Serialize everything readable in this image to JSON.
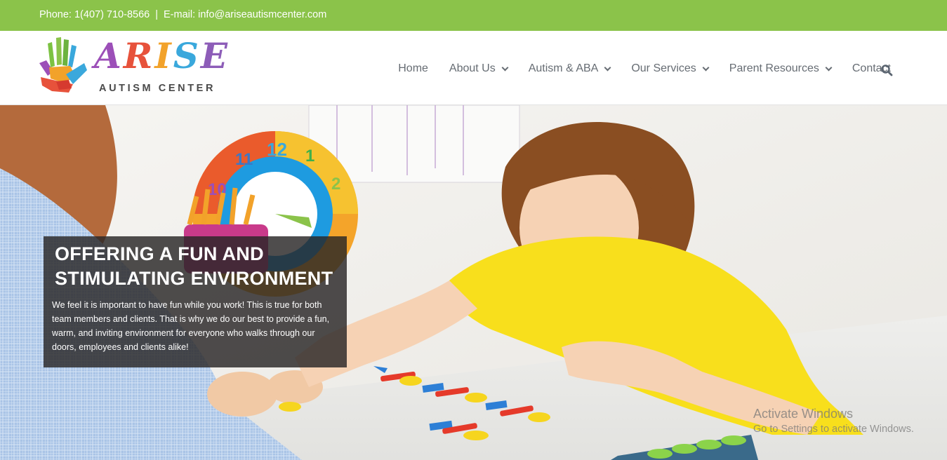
{
  "topbar": {
    "phone": "Phone: 1(407) 710-8566",
    "separator": "|",
    "email": "E-mail: info@ariseautismcenter.com"
  },
  "logo": {
    "letters": [
      "A",
      "R",
      "I",
      "S",
      "E"
    ],
    "subtitle": "AUTISM CENTER"
  },
  "nav": {
    "items": [
      {
        "label": "Home"
      },
      {
        "label": "About Us"
      },
      {
        "label": "Autism & ABA"
      },
      {
        "label": "Our Services"
      },
      {
        "label": "Parent Resources"
      },
      {
        "label": "Contact"
      }
    ],
    "search_icon": "search-icon"
  },
  "hero": {
    "title_line1": "OFFERING A FUN AND",
    "title_line2": "STIMULATING ENVIRONMENT",
    "body": "We feel it is important to have fun while you work! This is true for both team members and clients. That is why we do our best to provide a fun, warm, and inviting environment for everyone who walks through our doors, employees and clients alike!"
  },
  "watermark": {
    "line1": "Activate Windows",
    "line2": "Go to Settings to activate Windows."
  },
  "colors": {
    "topbar": "#8bc34a",
    "nav_text": "#666c73",
    "caption_bg": "#282626"
  }
}
